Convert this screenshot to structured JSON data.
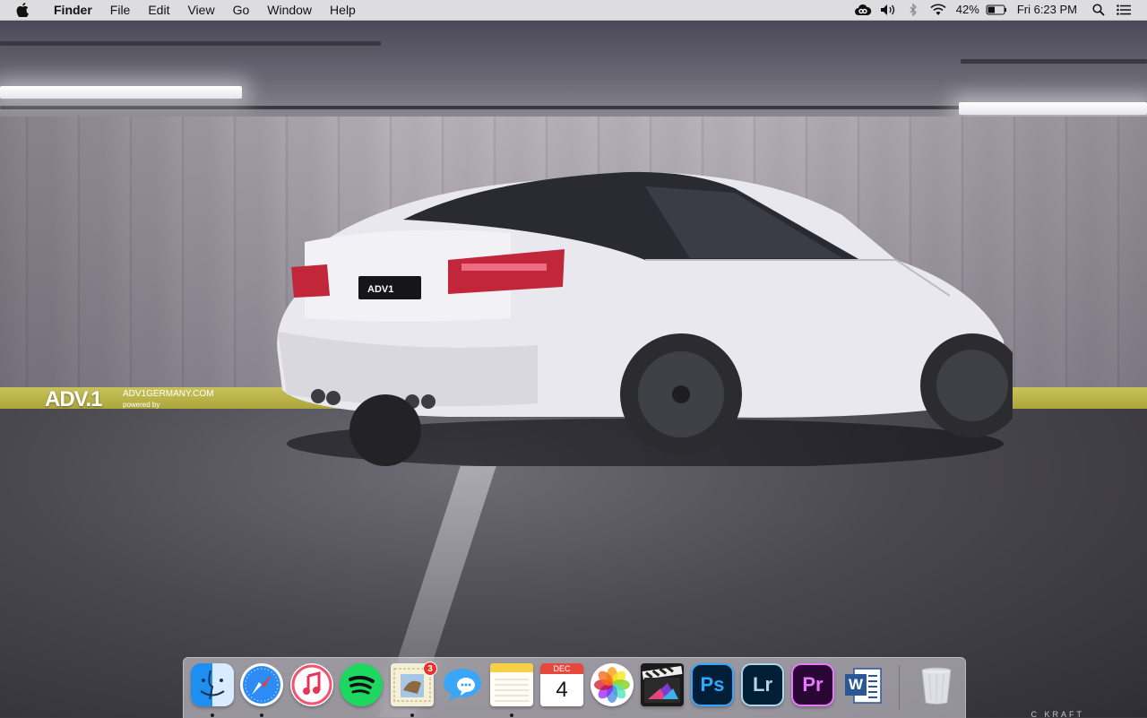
{
  "menubar": {
    "app_name": "Finder",
    "menus": [
      "File",
      "Edit",
      "View",
      "Go",
      "Window",
      "Help"
    ],
    "status": {
      "battery_percent": "42%",
      "clock": "Fri 6:23 PM"
    },
    "icons": [
      "apple-icon",
      "creative-cloud-icon",
      "volume-icon",
      "bluetooth-icon",
      "wifi-icon",
      "battery-icon",
      "spotlight-icon",
      "notification-center-icon"
    ]
  },
  "wallpaper": {
    "watermark_logo": "ADV.1",
    "watermark_site": "ADV1GERMANY.COM",
    "watermark_powered": "powered by",
    "plate_text": "ADV1",
    "signature": "C KRAFT"
  },
  "dock": {
    "apps": [
      {
        "name": "Finder",
        "running": true
      },
      {
        "name": "Safari",
        "running": true
      },
      {
        "name": "iTunes",
        "running": false
      },
      {
        "name": "Spotify",
        "running": false
      },
      {
        "name": "Mail",
        "running": true,
        "badge": "3"
      },
      {
        "name": "Messages",
        "running": false
      },
      {
        "name": "Notes",
        "running": true
      },
      {
        "name": "Calendar",
        "running": false,
        "month": "DEC",
        "day": "4"
      },
      {
        "name": "Photos",
        "running": false
      },
      {
        "name": "Final Cut Pro",
        "running": false
      },
      {
        "name": "Photoshop",
        "running": false,
        "label": "Ps"
      },
      {
        "name": "Lightroom",
        "running": false,
        "label": "Lr"
      },
      {
        "name": "Premiere Pro",
        "running": false,
        "label": "Pr"
      },
      {
        "name": "Microsoft Word",
        "running": false,
        "label": "W"
      },
      {
        "name": "Trash",
        "running": false
      }
    ]
  },
  "colors": {
    "photoshop": "#31a8ff",
    "lightroom": "#add5ec",
    "premiere": "#ea77ff",
    "adobe_bg": "#001e36",
    "spotify": "#1ed760",
    "badge": "#e9332a"
  }
}
